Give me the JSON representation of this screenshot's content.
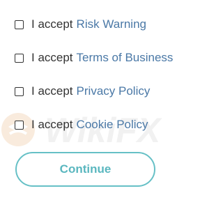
{
  "consents": [
    {
      "prefix": "I accept",
      "link": "Risk Warning"
    },
    {
      "prefix": "I accept",
      "link": "Terms of Business"
    },
    {
      "prefix": "I accept",
      "link": "Privacy Policy"
    },
    {
      "prefix": "I accept",
      "link": "Cookie Policy"
    }
  ],
  "continue_label": "Continue",
  "watermark": {
    "text": "WikiFX"
  },
  "colors": {
    "link": "#4a78a6",
    "text": "#333333",
    "button_accent": "#66c0c6"
  }
}
